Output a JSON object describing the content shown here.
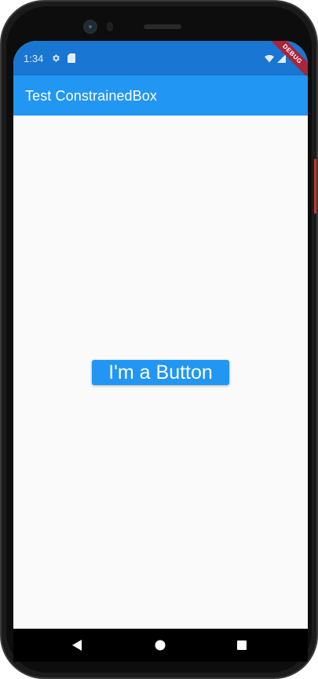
{
  "status_bar": {
    "time": "1:34",
    "icons": [
      "settings-icon",
      "sd-card-icon",
      "wifi-icon",
      "signal-icon"
    ]
  },
  "app_bar": {
    "title": "Test ConstrainedBox"
  },
  "debug_banner": {
    "label": "DEBUG"
  },
  "main": {
    "button_label": "I'm a Button"
  },
  "nav_bar": {
    "icons": [
      "back-icon",
      "home-icon",
      "recents-icon"
    ]
  },
  "colors": {
    "primary": "#2196f3",
    "primary_dark": "#1976d2",
    "background": "#fafafa",
    "debug_banner": "#a6263a"
  }
}
